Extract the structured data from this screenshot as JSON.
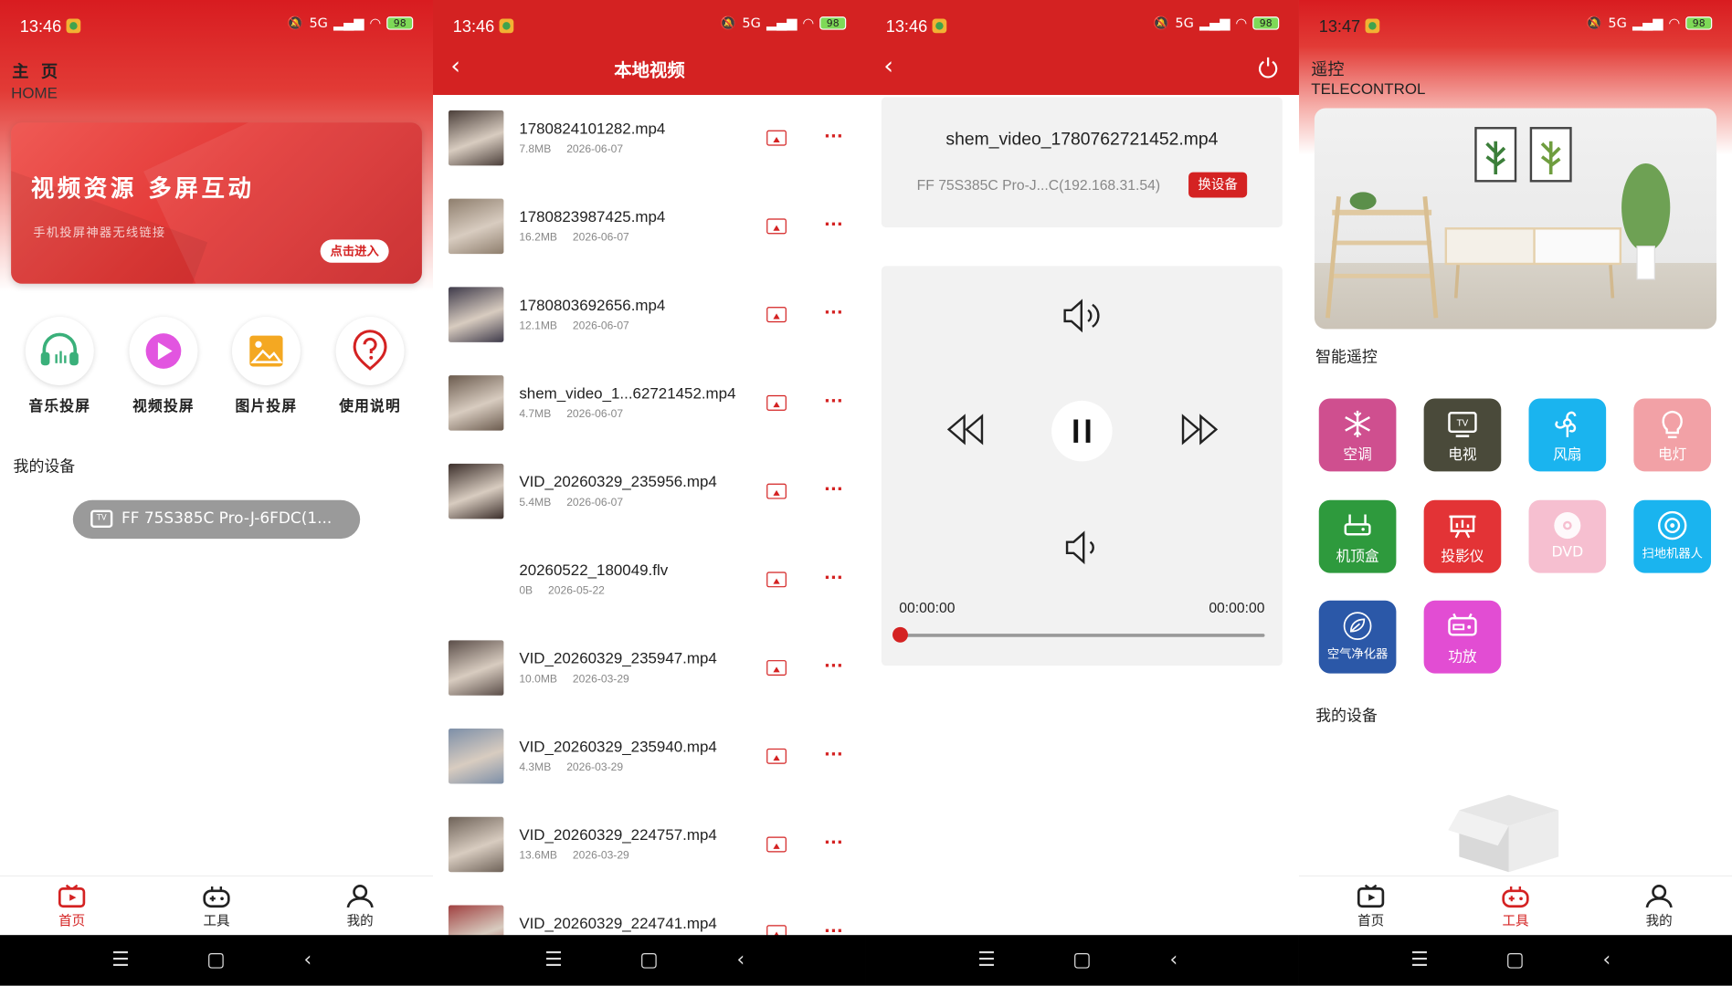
{
  "status": {
    "time_1": "13:46",
    "time_2": "13:46",
    "time_3": "13:46",
    "time_4": "13:47",
    "network": "5G",
    "battery": "98"
  },
  "home": {
    "title": "主 页",
    "subtitle": "HOME",
    "banner_title": "视频资源 多屏互动",
    "banner_subtitle": "手机投屏神器无线链接",
    "banner_button": "点击进入",
    "quick_actions": [
      {
        "label": "音乐投屏",
        "icon": "headphones-icon",
        "color": "#3ab07a"
      },
      {
        "label": "视频投屏",
        "icon": "play-icon",
        "color": "#e255e0"
      },
      {
        "label": "图片投屏",
        "icon": "image-icon",
        "color": "#f4a822"
      },
      {
        "label": "使用说明",
        "icon": "help-icon",
        "color": "#d42222"
      }
    ],
    "my_devices_label": "我的设备",
    "device_name": "FF 75S385C Pro-J-6FDC(1..."
  },
  "tabs": {
    "home": "首页",
    "tools": "工具",
    "mine": "我的"
  },
  "local_video": {
    "title": "本地视频",
    "items": [
      {
        "name": "1780824101282.mp4",
        "size": "7.8MB",
        "date": "2026-06-07"
      },
      {
        "name": "1780823987425.mp4",
        "size": "16.2MB",
        "date": "2026-06-07"
      },
      {
        "name": "1780803692656.mp4",
        "size": "12.1MB",
        "date": "2026-06-07"
      },
      {
        "name": "shem_video_1...62721452.mp4",
        "size": "4.7MB",
        "date": "2026-06-07"
      },
      {
        "name": "VID_20260329_235956.mp4",
        "size": "5.4MB",
        "date": "2026-06-07"
      },
      {
        "name": "20260522_180049.flv",
        "size": "0B",
        "date": "2026-05-22"
      },
      {
        "name": "VID_20260329_235947.mp4",
        "size": "10.0MB",
        "date": "2026-03-29"
      },
      {
        "name": "VID_20260329_235940.mp4",
        "size": "4.3MB",
        "date": "2026-03-29"
      },
      {
        "name": "VID_20260329_224757.mp4",
        "size": "13.6MB",
        "date": "2026-03-29"
      },
      {
        "name": "VID_20260329_224741.mp4",
        "size": "",
        "date": ""
      }
    ]
  },
  "player": {
    "file_name": "shem_video_1780762721452.mp4",
    "device_line": "FF 75S385C Pro-J...C(192.168.31.54)",
    "switch_button": "换设备",
    "time_current": "00:00:00",
    "time_total": "00:00:00",
    "progress": 0
  },
  "remote": {
    "title": "遥控",
    "subtitle": "TELECONTROL",
    "section_title": "智能遥控",
    "items": [
      {
        "label": "空调",
        "icon": "snowflake-icon",
        "color": "#cf4f8f"
      },
      {
        "label": "电视",
        "icon": "tv-icon",
        "color": "#4a4a3a"
      },
      {
        "label": "风扇",
        "icon": "fan-icon",
        "color": "#1ab4ef"
      },
      {
        "label": "电灯",
        "icon": "bulb-icon",
        "color": "#f2a1a6"
      },
      {
        "label": "机顶盒",
        "icon": "settop-box-icon",
        "color": "#2e9a3d"
      },
      {
        "label": "投影仪",
        "icon": "projector-icon",
        "color": "#e33336"
      },
      {
        "label": "DVD",
        "icon": "disc-icon",
        "color": "#f6bfd0"
      },
      {
        "label": "扫地机器人",
        "icon": "robot-vacuum-icon",
        "color": "#1ab4ef"
      },
      {
        "label": "空气净化器",
        "icon": "leaf-icon",
        "color": "#2b58a8"
      },
      {
        "label": "功放",
        "icon": "amplifier-icon",
        "color": "#e24dd3"
      }
    ],
    "my_devices_label": "我的设备"
  }
}
